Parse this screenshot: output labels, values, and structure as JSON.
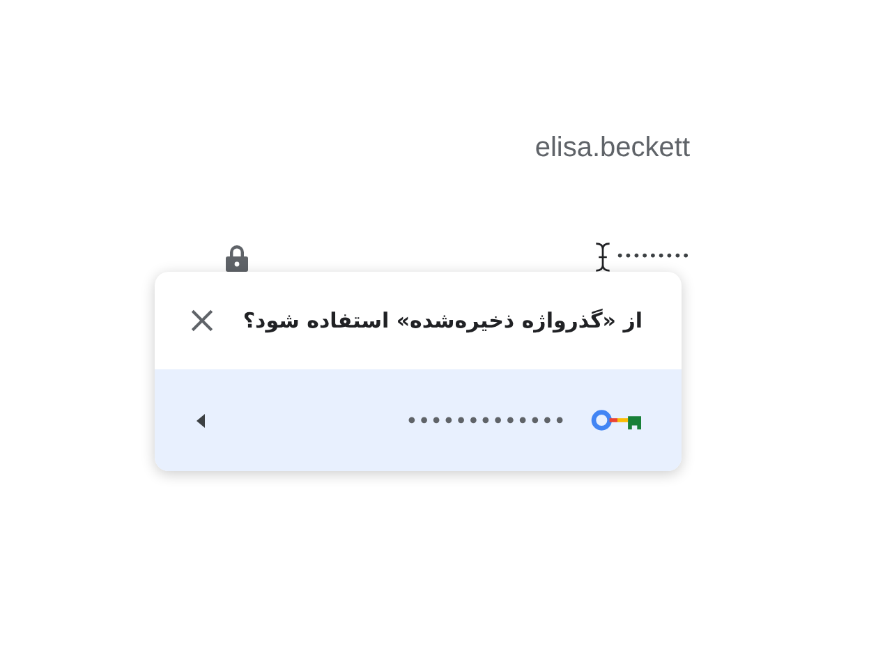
{
  "username": "elisa.beckett",
  "password_field": {
    "value": "•••••••••"
  },
  "popup": {
    "title": "از «گذرواژه ذخیره‌شده» استفاده شود؟",
    "suggestion": {
      "value": "•••••••••••••"
    }
  }
}
